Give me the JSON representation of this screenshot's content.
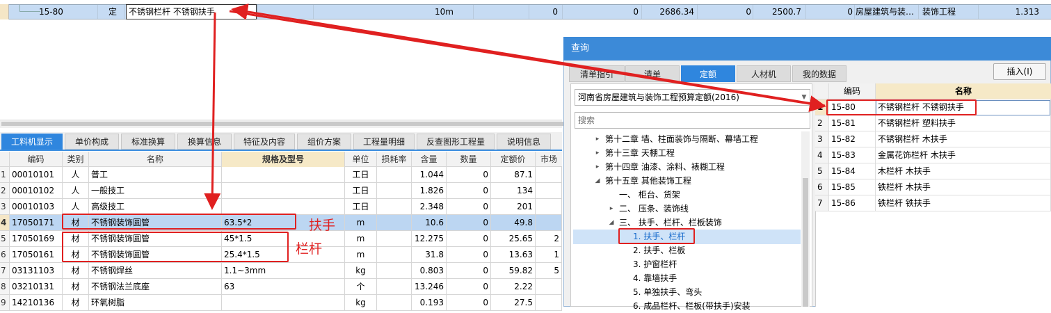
{
  "top_row": {
    "code": "15-80",
    "type": "定",
    "name": "不锈钢栏杆 不锈钢扶手",
    "unit": "10m",
    "v1": "0",
    "v2": "0",
    "v3": "2686.34",
    "v4": "0",
    "v5": "2500.7",
    "v6": "0",
    "major": "房屋建筑与装…",
    "category": "装饰工程",
    "amount": "1.313"
  },
  "bottom_tabs": [
    "工料机显示",
    "单价构成",
    "标准换算",
    "换算信息",
    "特征及内容",
    "组价方案",
    "工程量明细",
    "反查图形工程量",
    "说明信息"
  ],
  "bottom_table": {
    "headers": {
      "code": "编码",
      "type": "类别",
      "name": "名称",
      "spec": "规格及型号",
      "unit": "单位",
      "loss": "损耗率",
      "content": "含量",
      "qty": "数量",
      "price": "定额价",
      "market": "市场"
    },
    "rows": [
      {
        "n": "1",
        "code": "00010101",
        "type": "人",
        "name": "普工",
        "spec": "",
        "unit": "工日",
        "content": "1.044",
        "qty": "0",
        "price": "87.1",
        "market": ""
      },
      {
        "n": "2",
        "code": "00010102",
        "type": "人",
        "name": "一般技工",
        "spec": "",
        "unit": "工日",
        "content": "1.826",
        "qty": "0",
        "price": "134",
        "market": ""
      },
      {
        "n": "3",
        "code": "00010103",
        "type": "人",
        "name": "高级技工",
        "spec": "",
        "unit": "工日",
        "content": "2.348",
        "qty": "0",
        "price": "201",
        "market": ""
      },
      {
        "n": "4",
        "code": "17050171",
        "type": "材",
        "name": "不锈钢装饰圆管",
        "spec": "63.5*2",
        "unit": "m",
        "content": "10.6",
        "qty": "0",
        "price": "49.8",
        "market": ""
      },
      {
        "n": "5",
        "code": "17050169",
        "type": "材",
        "name": "不锈钢装饰圆管",
        "spec": "45*1.5",
        "unit": "m",
        "content": "12.275",
        "qty": "0",
        "price": "25.65",
        "market": "2"
      },
      {
        "n": "6",
        "code": "17050161",
        "type": "材",
        "name": "不锈钢装饰圆管",
        "spec": "25.4*1.5",
        "unit": "m",
        "content": "31.8",
        "qty": "0",
        "price": "13.63",
        "market": "1"
      },
      {
        "n": "7",
        "code": "03131103",
        "type": "材",
        "name": "不锈钢焊丝",
        "spec": "1.1~3mm",
        "unit": "kg",
        "content": "0.803",
        "qty": "0",
        "price": "59.82",
        "market": "5"
      },
      {
        "n": "8",
        "code": "03210131",
        "type": "材",
        "name": "不锈钢法兰底座",
        "spec": "63",
        "unit": "个",
        "content": "13.246",
        "qty": "0",
        "price": "2.22",
        "market": ""
      },
      {
        "n": "9",
        "code": "14210136",
        "type": "材",
        "name": "环氧树脂",
        "spec": "",
        "unit": "kg",
        "content": "0.193",
        "qty": "0",
        "price": "27.5",
        "market": ""
      }
    ]
  },
  "annotations": {
    "handrail": "扶手",
    "railing": "栏杆"
  },
  "dialog": {
    "title": "查询",
    "tabs": [
      "清单指引",
      "清单",
      "定额",
      "人材机",
      "我的数据"
    ],
    "insert_button": "插入(I)",
    "library": "河南省房屋建筑与装饰工程预算定额(2016)",
    "search_placeholder": "搜索",
    "tree": [
      {
        "label": "第十二章 墙、柱面装饰与隔断、幕墙工程",
        "arrow": "▸"
      },
      {
        "label": "第十三章 天棚工程",
        "arrow": "▸"
      },
      {
        "label": "第十四章 油漆、涂料、裱糊工程",
        "arrow": "▸"
      },
      {
        "label": "第十五章 其他装饰工程",
        "arrow": "◢"
      },
      {
        "label": "一、 柜台、货架",
        "arrow": ""
      },
      {
        "label": "二、 压条、装饰线",
        "arrow": "▸"
      },
      {
        "label": "三、 扶手、栏杆、栏板装饰",
        "arrow": "◢"
      },
      {
        "label": "1. 扶手、栏杆",
        "arrow": ""
      },
      {
        "label": "2. 扶手、栏板",
        "arrow": ""
      },
      {
        "label": "3. 护窗栏杆",
        "arrow": ""
      },
      {
        "label": "4. 靠墙扶手",
        "arrow": ""
      },
      {
        "label": "5. 单独扶手、弯头",
        "arrow": ""
      },
      {
        "label": "6. 成品栏杆、栏板(带扶手)安装",
        "arrow": ""
      }
    ],
    "result_headers": {
      "code": "编码",
      "name": "名称"
    },
    "results": [
      {
        "n": "1",
        "code": "15-80",
        "name": "不锈钢栏杆 不锈钢扶手"
      },
      {
        "n": "2",
        "code": "15-81",
        "name": "不锈钢栏杆 塑料扶手"
      },
      {
        "n": "3",
        "code": "15-82",
        "name": "不锈钢栏杆 木扶手"
      },
      {
        "n": "4",
        "code": "15-83",
        "name": "金属花饰栏杆 木扶手"
      },
      {
        "n": "5",
        "code": "15-84",
        "name": "木栏杆 木扶手"
      },
      {
        "n": "6",
        "code": "15-85",
        "name": "铁栏杆 木扶手"
      },
      {
        "n": "7",
        "code": "15-86",
        "name": "铁栏杆 铁扶手"
      }
    ]
  }
}
